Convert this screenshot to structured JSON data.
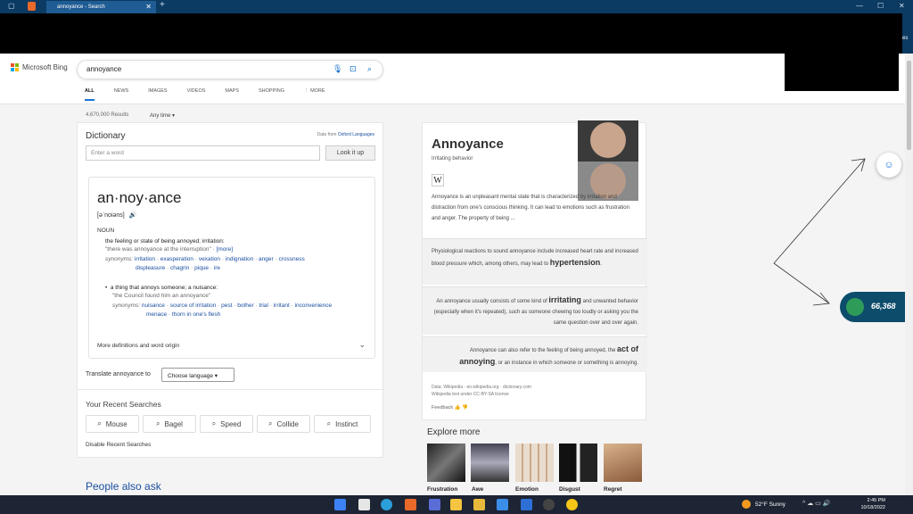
{
  "browser": {
    "tab_title": "annoyance - Search",
    "new_tab": "+",
    "close": "✕",
    "minimize": "—",
    "maximize": "☐",
    "window_close": "✕",
    "side_text": "es"
  },
  "bing": {
    "logo_text": "Microsoft Bing",
    "query": "annoyance",
    "nav": [
      "ALL",
      "NEWS",
      "IMAGES",
      "VIDEOS",
      "MAPS",
      "SHOPPING",
      "⋮ MORE"
    ]
  },
  "results": {
    "count": "4,670,000 Results",
    "time_filter": "Any time ▾"
  },
  "dictionary": {
    "title": "Dictionary",
    "source_prefix": "Data from ",
    "source_link": "Oxford Languages",
    "placeholder": "Enter a word",
    "lookup": "Look it up",
    "headword": "an·noy·ance",
    "pronunciation": "[əˈnoiəns]",
    "pos": "NOUN",
    "sense1": {
      "def": "the feeling or state of being annoyed; irritation:",
      "example": "\"there was annoyance at the interruption\" ·",
      "more": "[more]",
      "syn_label": "synonyms:",
      "syn_line1": [
        "irritation",
        "exasperation",
        "vexation",
        "indignation",
        "anger",
        "crossness"
      ],
      "syn_line2": [
        "displeasure",
        "chagrin",
        "pique",
        "ire"
      ]
    },
    "sense2": {
      "def": "a thing that annoys someone; a nuisance:",
      "example": "\"the Council found him an annoyance\"",
      "syn_label": "synonyms:",
      "syn_line1": [
        "nuisance",
        "source of irritation",
        "pest",
        "bother",
        "trial",
        "irritant",
        "inconvenience"
      ],
      "syn_line2": [
        "menace",
        "thorn in one's flesh"
      ]
    },
    "more_defs": "More definitions and word origin",
    "translate_label": "Translate annoyance to",
    "choose_language": "Choose language ▾",
    "recent_title": "Your Recent Searches",
    "recent": [
      "Mouse",
      "Bagel",
      "Speed",
      "Collide",
      "Instinct"
    ],
    "disable": "Disable Recent Searches"
  },
  "people_also_ask": "People also ask",
  "knowledge": {
    "title": "Annoyance",
    "subtitle": "Irritating behavior",
    "wiki": "W",
    "p1": "Annoyance is an unpleasant mental state that is characterized by irritation and distraction from one's conscious thinking. It can lead to emotions such as frustration and anger. The property of being ...",
    "p2": "Physiological reactions to sound annoyance include increased heart rate and increased blood pressure which, among others, may lead to",
    "p2_bold": "hypertension",
    "p3_a": "An annoyance usually consists of some kind of",
    "p3_bold": "irritating",
    "p3_b": "and unwanted behavior (especially when it's repeated), such as someone chewing too loudly or asking you the same question over and over again.",
    "p4_a": "Annoyance can also refer to the feeling of being annoyed, the",
    "p4_bold": "act of annoying",
    "p4_b": ", or an instance in which someone or something is annoying.",
    "data_line": "Data: Wikipedia · en.wikipedia.org · dictionary.com",
    "license": "Wikipedia text under CC-BY-SA license",
    "feedback": "Feedback 👍 👎"
  },
  "explore": {
    "title": "Explore more",
    "items": [
      "Frustration",
      "Awe",
      "Emotion",
      "Disgust",
      "Regret"
    ]
  },
  "rewards": {
    "points": "66,368"
  },
  "taskbar": {
    "weather": "52°F  Sunny",
    "time": "2:45 PM",
    "date": "10/18/2022",
    "tray": "^ ☁ ▭ 🔊"
  }
}
